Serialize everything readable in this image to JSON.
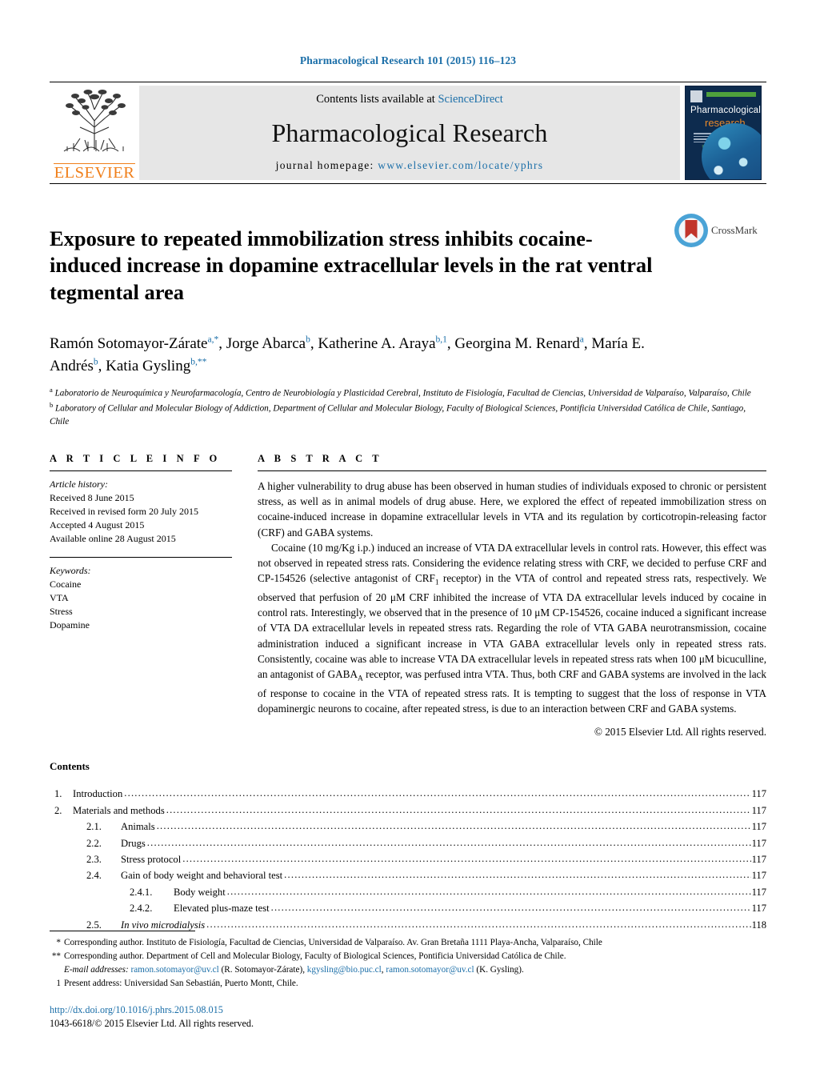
{
  "running_head": "Pharmacological Research 101 (2015) 116–123",
  "masthead": {
    "publisher_wordmark": "ELSEVIER",
    "contents_prefix": "Contents lists available at ",
    "contents_link": "ScienceDirect",
    "journal_name": "Pharmacological Research",
    "homepage_prefix": "journal homepage: ",
    "homepage_url": "www.elsevier.com/locate/yphrs",
    "cover": {
      "line1": "Pharmacological",
      "line2": "research"
    }
  },
  "crossmark": {
    "label": "CrossMark"
  },
  "article": {
    "title": "Exposure to repeated immobilization stress inhibits cocaine-induced increase in dopamine extracellular levels in the rat ventral tegmental area",
    "authors": [
      {
        "name": "Ramón Sotomayor-Zárate",
        "marks": "a,*"
      },
      {
        "name": "Jorge Abarca",
        "marks": "b"
      },
      {
        "name": "Katherine A. Araya",
        "marks": "b,1"
      },
      {
        "name": "Georgina M. Renard",
        "marks": "a"
      },
      {
        "name": "María E. Andrés",
        "marks": "b"
      },
      {
        "name": "Katia Gysling",
        "marks": "b,**"
      }
    ],
    "affiliations": [
      {
        "mark": "a",
        "text": "Laboratorio de Neuroquímica y Neurofarmacología, Centro de Neurobiología y Plasticidad Cerebral, Instituto de Fisiología, Facultad de Ciencias, Universidad de Valparaíso, Valparaíso, Chile"
      },
      {
        "mark": "b",
        "text": "Laboratory of Cellular and Molecular Biology of Addiction, Department of Cellular and Molecular Biology, Faculty of Biological Sciences, Pontificia Universidad Católica de Chile, Santiago, Chile"
      }
    ]
  },
  "article_info": {
    "heading": "A R T I C L E   I N F O",
    "history_title": "Article history:",
    "history": [
      "Received 8 June 2015",
      "Received in revised form 20 July 2015",
      "Accepted 4 August 2015",
      "Available online 28 August 2015"
    ],
    "keywords_title": "Keywords:",
    "keywords": [
      "Cocaine",
      "VTA",
      "Stress",
      "Dopamine"
    ]
  },
  "abstract": {
    "heading": "A B S T R A C T",
    "paragraph1": "A higher vulnerability to drug abuse has been observed in human studies of individuals exposed to chronic or persistent stress, as well as in animal models of drug abuse. Here, we explored the effect of repeated immobilization stress on cocaine-induced increase in dopamine extracellular levels in VTA and its regulation by corticotropin-releasing factor (CRF) and GABA systems.",
    "paragraph2_a": "Cocaine (10 mg/Kg i.p.) induced an increase of VTA DA extracellular levels in control rats. However, this effect was not observed in repeated stress rats. Considering the evidence relating stress with CRF, we decided to perfuse CRF and CP-154526 (selective antagonist of CRF",
    "paragraph2_sub1": "1",
    "paragraph2_b": " receptor) in the VTA of control and repeated stress rats, respectively. We observed that perfusion of 20 μM CRF inhibited the increase of VTA DA extracellular levels induced by cocaine in control rats. Interestingly, we observed that in the presence of 10 μM CP-154526, cocaine induced a significant increase of VTA DA extracellular levels in repeated stress rats. Regarding the role of VTA GABA neurotransmission, cocaine administration induced a significant increase in VTA GABA extracellular levels only in repeated stress rats. Consistently, cocaine was able to increase VTA DA extracellular levels in repeated stress rats when 100 μM bicuculline, an antagonist of GABA",
    "paragraph2_sub2": "A",
    "paragraph2_c": " receptor, was perfused intra VTA. Thus, both CRF and GABA systems are involved in the lack of response to cocaine in the VTA of repeated stress rats. It is tempting to suggest that the loss of response in VTA dopaminergic neurons to cocaine, after repeated stress, is due to an interaction between CRF and GABA systems.",
    "copyright": "© 2015 Elsevier Ltd. All rights reserved."
  },
  "contents": {
    "title": "Contents",
    "entries": [
      {
        "level": 1,
        "num": "1.",
        "label": "Introduction",
        "page": "117",
        "italic": false
      },
      {
        "level": 1,
        "num": "2.",
        "label": "Materials and methods",
        "page": "117",
        "italic": false
      },
      {
        "level": 2,
        "num": "2.1.",
        "label": "Animals",
        "page": "117",
        "italic": false
      },
      {
        "level": 2,
        "num": "2.2.",
        "label": "Drugs",
        "page": "117",
        "italic": false
      },
      {
        "level": 2,
        "num": "2.3.",
        "label": "Stress protocol",
        "page": "117",
        "italic": false
      },
      {
        "level": 2,
        "num": "2.4.",
        "label": "Gain of body weight and behavioral test",
        "page": "117",
        "italic": false
      },
      {
        "level": 3,
        "num": "2.4.1.",
        "label": "Body weight",
        "page": "117",
        "italic": false
      },
      {
        "level": 3,
        "num": "2.4.2.",
        "label": "Elevated plus-maze test",
        "page": "117",
        "italic": false
      },
      {
        "level": 2,
        "num": "2.5.",
        "label": "In vivo microdialysis",
        "page": "118",
        "italic": true
      }
    ]
  },
  "footnotes": [
    {
      "mark": "*",
      "text": "Corresponding author. Instituto de Fisiología, Facultad de Ciencias, Universidad de Valparaíso. Av. Gran Bretaña 1111 Playa-Ancha, Valparaíso, Chile"
    },
    {
      "mark": "**",
      "text": "Corresponding author. Department of Cell and Molecular Biology, Faculty of Biological Sciences, Pontificia Universidad Católica de Chile."
    }
  ],
  "email_note": {
    "label": "E-mail addresses:",
    "emails": [
      {
        "address": "ramon.sotomayor@uv.cl",
        "owner": " (R. Sotomayor-Zárate), "
      },
      {
        "address": "kgysling@bio.puc.cl",
        "owner": ", "
      },
      {
        "address": "ramon.sotomayor@uv.cl",
        "owner": " (K. Gysling)."
      }
    ]
  },
  "present_address": {
    "mark": "1",
    "text": "Present address: Universidad San Sebastián, Puerto Montt, Chile."
  },
  "doi": {
    "url": "http://dx.doi.org/10.1016/j.phrs.2015.08.015",
    "issn_line": "1043-6618/© 2015 Elsevier Ltd. All rights reserved."
  },
  "colors": {
    "link": "#1a6ea8",
    "elsevier_orange": "#f07f1a",
    "cover_navy": "#0d2b4e",
    "cover_green": "#4fa03c",
    "crossmark_blue": "#4aa3d6",
    "crossmark_red": "#c1352b"
  }
}
